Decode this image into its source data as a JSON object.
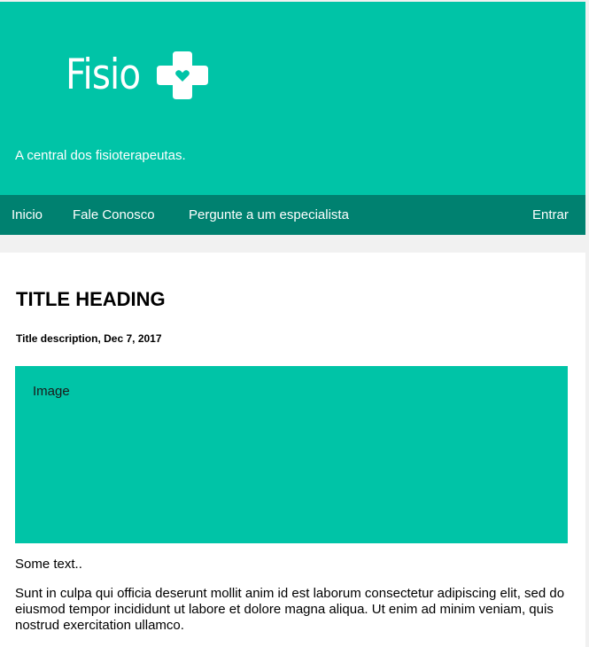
{
  "header": {
    "logo_text": "Fisio",
    "logo_icon": "medical-cross-heart-icon",
    "tagline": "A central dos fisioterapeutas.",
    "background_color": "#00c4a7"
  },
  "navbar": {
    "items": [
      {
        "label": "Inicio"
      },
      {
        "label": "Fale Conosco"
      },
      {
        "label": "Pergunte a um especialista"
      }
    ],
    "login_label": "Entrar",
    "background_color": "#008170"
  },
  "post": {
    "title": "TITLE HEADING",
    "description": "Title description, Dec 7, 2017",
    "image_label": "Image",
    "intro_text": "Some text..",
    "body_text": "Sunt in culpa qui officia deserunt mollit anim id est laborum consectetur adipiscing elit, sed do eiusmod tempor incididunt ut labore et dolore magna aliqua. Ut enim ad minim veniam, quis nostrud exercitation ullamco."
  }
}
